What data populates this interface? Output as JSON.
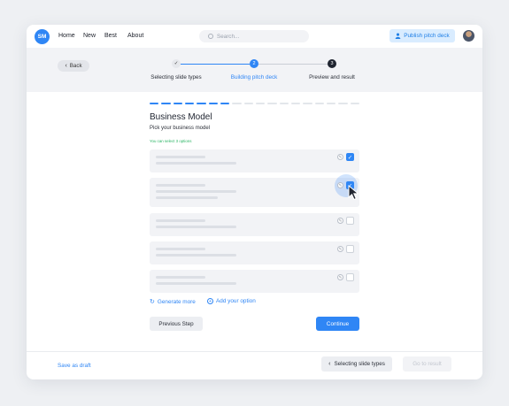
{
  "topbar": {
    "logo": "SM",
    "nav": [
      "Home",
      "New",
      "Best",
      "About"
    ],
    "search_placeholder": "Search...",
    "publish_label": "Publish pitch deck",
    "publish_icon": "user-icon",
    "avatar_icon": "avatar"
  },
  "stepper": {
    "back_label": "Back",
    "steps": [
      {
        "marker": "✓",
        "label": "Selecting slide types",
        "state": "done"
      },
      {
        "marker": "2",
        "label": "Building pitch deck",
        "state": "active"
      },
      {
        "marker": "3",
        "label": "Preview and result",
        "state": "upcoming"
      }
    ]
  },
  "progress": {
    "segments_total": 18,
    "segments_filled": 7
  },
  "content": {
    "title": "Business Model",
    "subtitle": "Pick your business model",
    "hint": "You can select 3 options",
    "options": [
      {
        "checked": true
      },
      {
        "checked": true
      },
      {
        "checked": false
      },
      {
        "checked": false
      },
      {
        "checked": false
      }
    ],
    "generate_more": "Generate more",
    "add_option": "Add your option",
    "previous_step": "Previous Step",
    "continue": "Continue"
  },
  "footer": {
    "save_draft": "Save as draft",
    "back_to": "Selecting slide types",
    "go_to_result": "Go to result"
  },
  "colors": {
    "accent": "#2f86f5",
    "success": "#28b463",
    "band": "#f2f3f6"
  }
}
